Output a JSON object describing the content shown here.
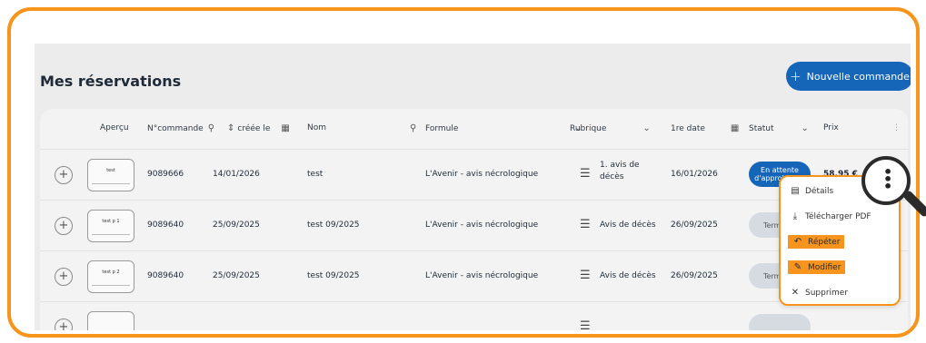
{
  "page": {
    "title": "Mes réservations",
    "new_order_label": "Nouvelle commande"
  },
  "columns": {
    "apercu": "Aperçu",
    "commande": "N°commande",
    "creee": "créée le",
    "nom": "Nom",
    "formule": "Formule",
    "rubrique": "Rubrique",
    "premiere_date": "1re date",
    "statut": "Statut",
    "prix": "Prix"
  },
  "rows": [
    {
      "thumb": "test",
      "commande": "9089666",
      "creee": "14/01/2026",
      "nom": "test",
      "formule": "L'Avenir - avis nécrologique",
      "rubrique_1": "1. avis de",
      "rubrique_2": "décès",
      "date": "16/01/2026",
      "statut_1": "En attente",
      "statut_2": "d'approbation",
      "prix": "58,95 €"
    },
    {
      "thumb": "test p 1",
      "commande": "9089640",
      "creee": "25/09/2025",
      "nom": "test 09/2025",
      "formule": "L'Avenir - avis nécrologique",
      "rubrique_1": "Avis de décès",
      "date": "26/09/2025",
      "statut_1": "Term"
    },
    {
      "thumb": "test p 2",
      "commande": "9089640",
      "creee": "25/09/2025",
      "nom": "test 09/2025",
      "formule": "L'Avenir - avis nécrologique",
      "rubrique_1": "Avis de décès",
      "date": "26/09/2025",
      "statut_1": "Term"
    }
  ],
  "menu": {
    "details": "Détails",
    "pdf": "Télécharger PDF",
    "repeter": "Répéter",
    "modifier": "Modifier",
    "supprimer": "Supprimer"
  },
  "colors": {
    "accent": "#f7941d",
    "primary": "#1565b8"
  }
}
